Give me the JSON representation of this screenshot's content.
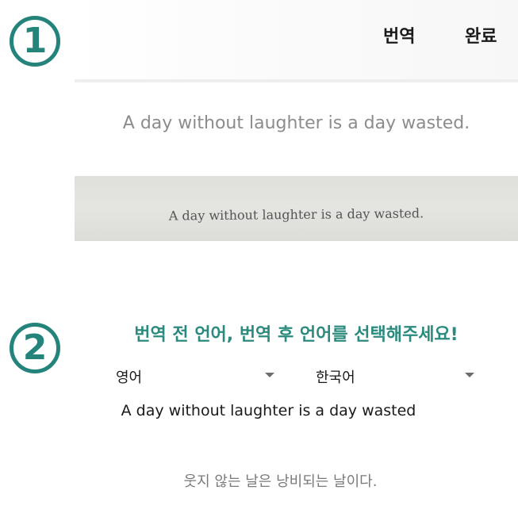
{
  "steps": {
    "step1": "1",
    "step2": "2"
  },
  "header": {
    "translate_label": "번역",
    "done_label": "완료"
  },
  "recognized": {
    "text": "A day without laughter is a day wasted."
  },
  "photo": {
    "text": "A day without laughter is a day wasted."
  },
  "section2": {
    "title": "번역 전 언어, 번역 후 언어를 선택해주세요!"
  },
  "languages": {
    "source": "영어",
    "target": "한국어"
  },
  "source_text": "A day without laughter is a day wasted",
  "result_text": "웃지 않는 날은 낭비되는 날이다.",
  "colors": {
    "accent": "#24847c",
    "title": "#2b8a7e"
  }
}
